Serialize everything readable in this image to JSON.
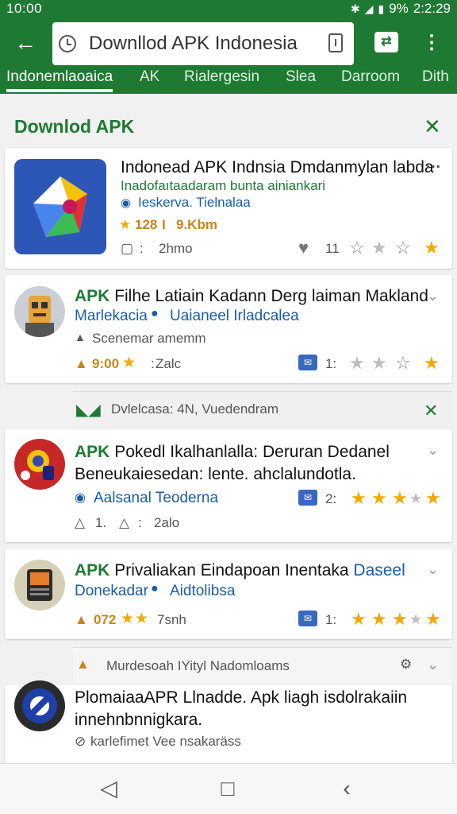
{
  "status": {
    "time": "10:00",
    "battery": "9%",
    "clock_right": "2:2:29"
  },
  "search": {
    "query": "Downllod APK Indonesia"
  },
  "tabs": [
    "Indonemlaoaica",
    "AK",
    "Rialergesin",
    "Slea",
    "Darroom",
    "Dith"
  ],
  "section": {
    "title": "Downlod APK"
  },
  "card1": {
    "title": "Indonead APK Indnsia Dmdanmylan labda",
    "subtitle": "Inadofaıtaadaram bunta ainiankari",
    "author": "Ieskerva. Tielnalaa",
    "rating": "128",
    "downloads": "9.Kbm",
    "time": "2hmo",
    "likes": "11",
    "menu": "…"
  },
  "card2": {
    "title_apk": "APK",
    "title": "Filhe Latiain Kadann Derg laiman Makland",
    "source_a": "Marlekacia",
    "source_b": "Uaianeel Irladcalea",
    "subtitle": "Scenemar amemm",
    "rating": "9:00",
    "time": "Zalc",
    "comments": "1:"
  },
  "band1": {
    "text": "Dvlelcasa: 4N, Vuedendram"
  },
  "card3": {
    "title_apk": "APK",
    "title": "Pokedl Ikalhanlalla: Deruran Dedanel",
    "title2": "Beneukaiesedan: lente. ahclalundotla.",
    "author": "Aalsanal Teoderna",
    "comments": "2:",
    "likes": "1.",
    "time": "2alo"
  },
  "card4": {
    "title_apk": "APK",
    "title": "Privaliakan Eindapoan Inentaka",
    "title_blue": "Daseel",
    "source_a": "Donekadar",
    "source_b": "Aidtolibsa",
    "rating": "072",
    "time": "7snh",
    "comments": "1:"
  },
  "band2": {
    "text": "Murdesoah IYityl Nadomloams"
  },
  "card5": {
    "title": "PlomaiaaAPR Llnadde. Apk liagh isdolrakaiin",
    "title2": "innehnbnnigkara.",
    "author": "karlefimet Vee nsakaräss"
  },
  "colors": {
    "brand_green": "#1e7a32",
    "link_blue": "#1a5ca8",
    "star_gold": "#f2a900"
  }
}
